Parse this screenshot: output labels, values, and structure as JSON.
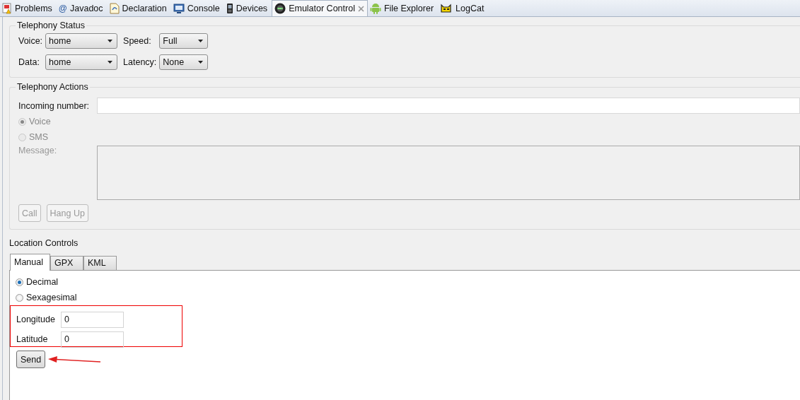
{
  "tabs": [
    {
      "kind": "problems",
      "label": "Problems",
      "selected": false
    },
    {
      "kind": "javadoc",
      "glyph": "@",
      "label": "Javadoc",
      "selected": false
    },
    {
      "kind": "declaration",
      "label": "Declaration",
      "selected": false
    },
    {
      "kind": "console",
      "label": "Console",
      "selected": false
    },
    {
      "kind": "devices",
      "label": "Devices",
      "selected": false
    },
    {
      "kind": "emulator",
      "label": "Emulator Control",
      "selected": true
    },
    {
      "kind": "android",
      "label": "File Explorer",
      "selected": false
    },
    {
      "kind": "logcat",
      "label": "LogCat",
      "selected": false
    }
  ],
  "telephony_status": {
    "title": "Telephony Status",
    "fields": [
      {
        "label": "Voice:",
        "value": "home"
      },
      {
        "label": "Speed:",
        "value": "Full"
      },
      {
        "label": "Data:",
        "value": "home"
      },
      {
        "label": "Latency:",
        "value": "None"
      }
    ]
  },
  "telephony_actions": {
    "title": "Telephony Actions",
    "incoming_number": {
      "label": "Incoming number:"
    },
    "mode": [
      {
        "label": "Voice",
        "selected": true,
        "disabled": true
      },
      {
        "label": "SMS",
        "selected": false,
        "disabled": true
      }
    ],
    "message": {
      "label": "Message:",
      "disabled": true
    },
    "buttons": [
      {
        "label": "Call",
        "disabled": true
      },
      {
        "label": "Hang Up",
        "disabled": true
      }
    ]
  },
  "location_controls": {
    "title": "Location Controls",
    "tabs": [
      {
        "label": "Manual",
        "selected": true
      },
      {
        "label": "GPX",
        "selected": false
      },
      {
        "label": "KML",
        "selected": false
      }
    ],
    "format": [
      {
        "label": "Decimal",
        "selected": true
      },
      {
        "label": "Sexagesimal",
        "selected": false
      }
    ],
    "fields": [
      {
        "label": "Longitude",
        "value": "0"
      },
      {
        "label": "Latitude",
        "value": "0"
      }
    ],
    "send_button": "Send"
  }
}
